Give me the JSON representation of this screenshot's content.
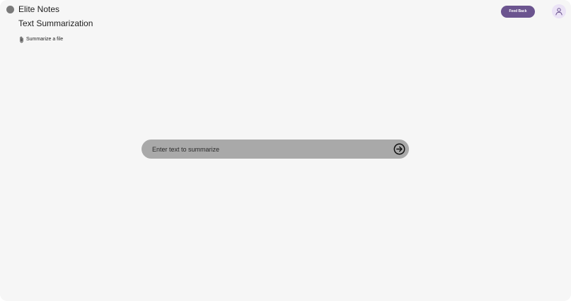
{
  "header": {
    "app_title": "Elite Notes",
    "page_title": "Text Summarization",
    "logo_icon": "circle-logo-icon"
  },
  "toolbar": {
    "summarize_file_label": "Summarize a file",
    "summarize_file_icon": "paperclip-icon",
    "feedback_label": "Feed Back",
    "profile_icon": "user-icon"
  },
  "prompt": {
    "placeholder": "Enter text to summarize",
    "value": "",
    "submit_icon": "arrow-right-circle-icon"
  },
  "colors": {
    "background": "#f6f6f6",
    "accent": "#6b548f",
    "avatar_background": "#ebe3f6",
    "prompt_bar": "#a9a9a9"
  }
}
